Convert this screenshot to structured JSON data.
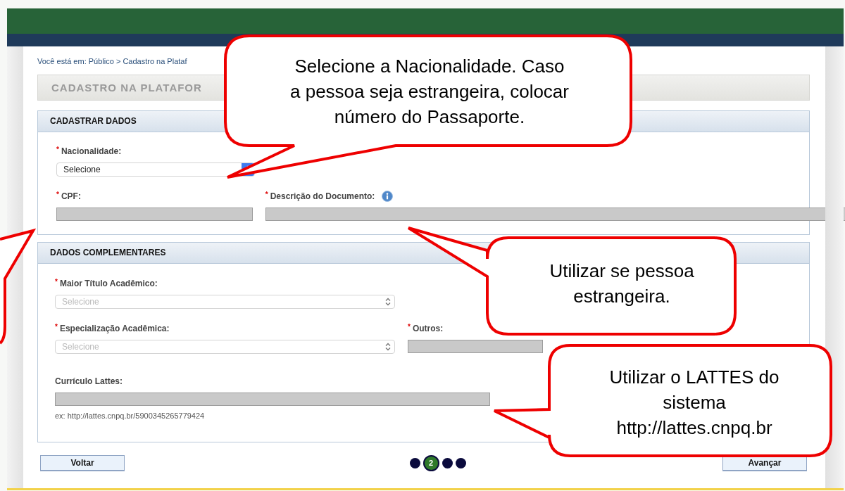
{
  "breadcrumb": "Você está em: Público > Cadastro na Plataf",
  "page_title": "CADASTRO NA PLATAFOR",
  "sections": [
    {
      "title": "CADASTRAR DADOS",
      "rows": [
        [
          {
            "kind": "select",
            "marker": "*",
            "label": "Nacionalidade:",
            "value": "Selecione",
            "disabled": false
          }
        ],
        [
          {
            "kind": "text",
            "marker": "*",
            "label": "CPF:",
            "disabled": true
          },
          {
            "kind": "text",
            "marker": "*",
            "label": "Descrição do Documento:",
            "info": true,
            "disabled": true
          }
        ]
      ]
    },
    {
      "title": "DADOS COMPLEMENTARES",
      "rows": [
        [
          {
            "kind": "select",
            "marker": "*",
            "label": "Maior Título Acadêmico:",
            "value": "Selecione",
            "disabled": true
          }
        ],
        [
          {
            "kind": "select",
            "marker": "*",
            "label": "Especialização Acadêmica:",
            "value": "Selecione",
            "disabled": true
          },
          {
            "kind": "text",
            "marker": "*",
            "label": "Outros:",
            "disabled": true
          }
        ],
        [
          {
            "kind": "text",
            "label": "Currículo Lattes:",
            "hint": "ex: http://lattes.cnpq.br/5900345265779424",
            "disabled": true
          }
        ]
      ]
    }
  ],
  "buttons": [
    {
      "label": "Voltar"
    },
    {
      "label": "Avançar"
    }
  ],
  "steps": [
    {
      "selected": false
    },
    {
      "selected": true,
      "label": "2"
    },
    {
      "selected": false
    },
    {
      "selected": false
    }
  ],
  "callouts": [
    {
      "text": "Selecione a Nacionalidade. Caso\na pessoa seja estrangeira, colocar\nnúmero do Passaporte."
    },
    {
      "text": "Utilizar se pessoa\nestrangeira."
    },
    {
      "text": "Utilizar o LATTES do\nsistema\nhttp://lattes.cnpq.br"
    }
  ]
}
